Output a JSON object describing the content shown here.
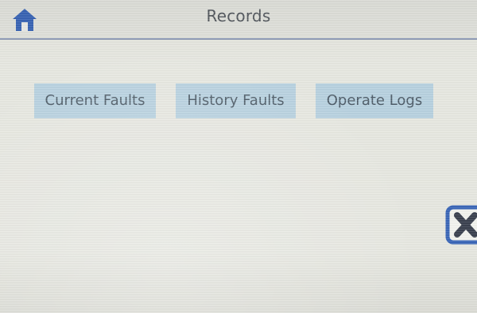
{
  "header": {
    "title": "Records",
    "home_icon": "home-icon"
  },
  "menu": {
    "buttons": [
      {
        "label": "Current Faults"
      },
      {
        "label": "History Faults"
      },
      {
        "label": "Operate Logs"
      }
    ]
  },
  "close": {
    "icon": "close-icon"
  },
  "colors": {
    "accent": "#3a66b8",
    "button_bg": "#b8d2e0",
    "header_rule": "#8c9ab6",
    "text": "#4e5c68"
  }
}
